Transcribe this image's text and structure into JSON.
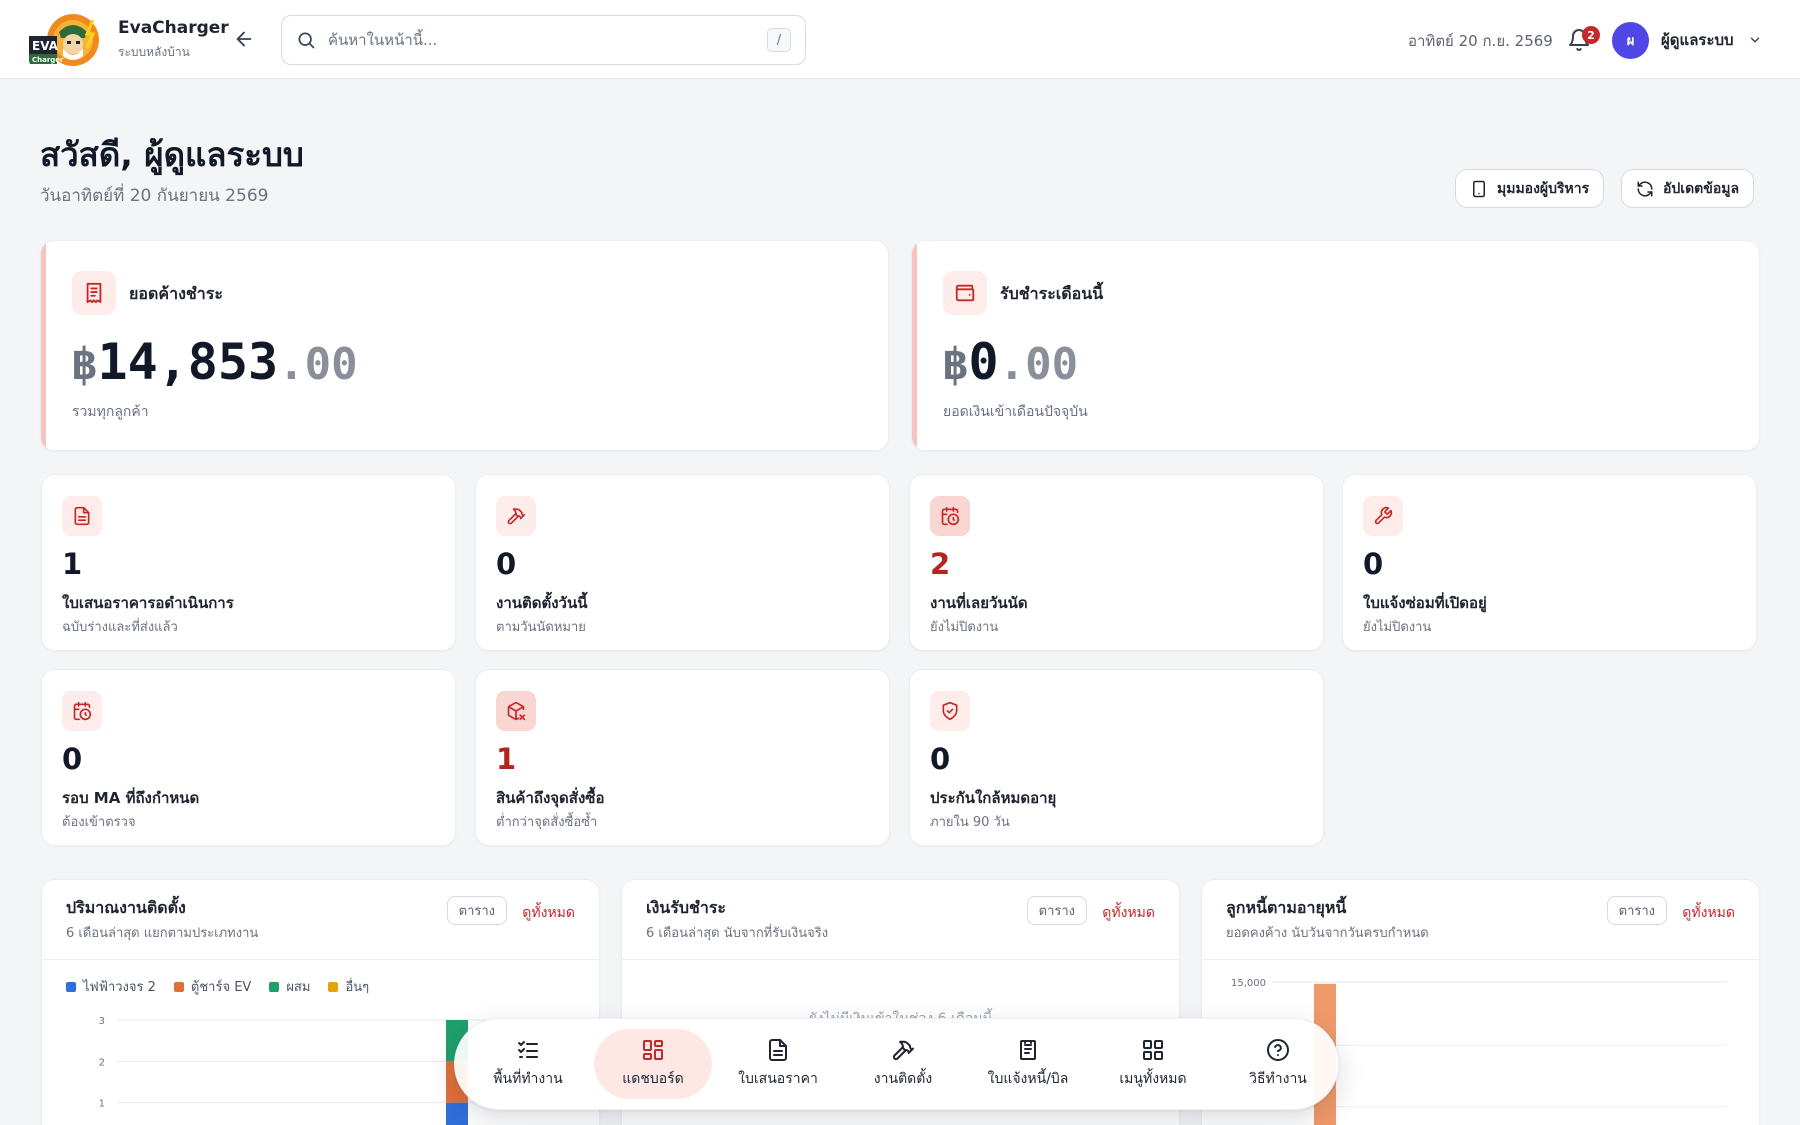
{
  "app": {
    "name": "EvaCharger",
    "subtitle": "ระบบหลังบ้าน",
    "logo_text": "EVA",
    "logo_subtext": "Charger"
  },
  "header": {
    "search_placeholder": "ค้นหาในหน้านี้...",
    "search_shortcut": "/",
    "date": "อาทิตย์ 20 ก.ย. 2569",
    "notification_count": "2",
    "user_initial": "ผ",
    "user_name": "ผู้ดูแลระบบ"
  },
  "greeting": {
    "title": "สวัสดี, ผู้ดูแลระบบ",
    "date": "วันอาทิตย์ที่ 20 กันยายน 2569",
    "executive_view_label": "มุมมองผู้บริหาร",
    "refresh_label": "อัปเดตข้อมูล"
  },
  "money_cards": [
    {
      "label": "ยอดค้างชำระ",
      "currency": "฿",
      "amount": "14,853",
      "decimals": ".00",
      "sub": "รวมทุกลูกค้า",
      "icon": "receipt-icon"
    },
    {
      "label": "รับชำระเดือนนี้",
      "currency": "฿",
      "amount": "0",
      "decimals": ".00",
      "sub": "ยอดเงินเข้าเดือนปัจจุบัน",
      "icon": "wallet-icon"
    }
  ],
  "stats": [
    {
      "value": "1",
      "label": "ใบเสนอราคารอดำเนินการ",
      "sub": "ฉบับร่างและที่ส่งแล้ว",
      "icon": "document-icon",
      "highlight": false
    },
    {
      "value": "0",
      "label": "งานติดตั้งวันนี้",
      "sub": "ตามวันนัดหมาย",
      "icon": "hammer-icon",
      "highlight": false
    },
    {
      "value": "2",
      "label": "งานที่เลยวันนัด",
      "sub": "ยังไม่ปิดงาน",
      "icon": "calendar-clock-icon",
      "highlight": true
    },
    {
      "value": "0",
      "label": "ใบแจ้งซ่อมที่เปิดอยู่",
      "sub": "ยังไม่ปิดงาน",
      "icon": "wrench-icon",
      "highlight": false
    },
    {
      "value": "0",
      "label": "รอบ MA ที่ถึงกำหนด",
      "sub": "ต้องเข้าตรวจ",
      "icon": "calendar-clock-icon",
      "highlight": false
    },
    {
      "value": "1",
      "label": "สินค้าถึงจุดสั่งซื้อ",
      "sub": "ต่ำกว่าจุดสั่งซื้อซ้ำ",
      "icon": "package-x-icon",
      "highlight": true
    },
    {
      "value": "0",
      "label": "ประกันใกล้หมดอายุ",
      "sub": "ภายใน 90 วัน",
      "icon": "shield-check-icon",
      "highlight": false
    }
  ],
  "panels": [
    {
      "title": "ปริมาณงานติดตั้ง",
      "sub": "6 เดือนล่าสุด แยกตามประเภทงาน",
      "table_label": "ตาราง",
      "view_all_label": "ดูทั้งหมด",
      "legend": [
        {
          "name": "ไฟฟ้าวงจร 2",
          "color": "#2f6fdb"
        },
        {
          "name": "ตู้ชาร์จ EV",
          "color": "#e0703a"
        },
        {
          "name": "ผสม",
          "color": "#1fa06b"
        },
        {
          "name": "อื่นๆ",
          "color": "#e5a50a"
        }
      ]
    },
    {
      "title": "เงินรับชำระ",
      "sub": "6 เดือนล่าสุด นับจากที่รับเงินจริง",
      "table_label": "ตาราง",
      "view_all_label": "ดูทั้งหมด",
      "empty_message": "ยังไม่มีเงินเข้าในช่วง 6 เดือนนี้"
    },
    {
      "title": "ลูกหนี้ตามอายุหนี้",
      "sub": "ยอดคงค้าง นับวันจากวันครบกำหนด",
      "table_label": "ตาราง",
      "view_all_label": "ดูทั้งหมด"
    }
  ],
  "chart_data": [
    {
      "type": "bar",
      "stacked": true,
      "y_ticks": [
        "1",
        "2",
        "3"
      ],
      "ylim": [
        0,
        3
      ],
      "series": [
        {
          "name": "ไฟฟ้าวงจร 2",
          "color": "#2f6fdb",
          "values": [
            1
          ]
        },
        {
          "name": "ตู้ชาร์จ EV",
          "color": "#e0703a",
          "values": [
            1
          ]
        },
        {
          "name": "ผสม",
          "color": "#1fa06b",
          "values": [
            1
          ]
        },
        {
          "name": "อื่นๆ",
          "color": "#e5a50a",
          "values": [
            0
          ]
        }
      ]
    },
    {
      "type": "bar",
      "y_ticks": [
        "15,000"
      ],
      "ylim": [
        0,
        15000
      ],
      "series": [
        {
          "color": "#ef9a6a",
          "values": [
            14853
          ]
        }
      ]
    }
  ],
  "dock": [
    {
      "label": "พื้นที่ทำงาน",
      "icon": "list-check-icon",
      "active": false
    },
    {
      "label": "แดชบอร์ด",
      "icon": "grid-icon",
      "active": true
    },
    {
      "label": "ใบเสนอราคา",
      "icon": "document-icon",
      "active": false
    },
    {
      "label": "งานติดตั้ง",
      "icon": "hammer-icon",
      "active": false
    },
    {
      "label": "ใบแจ้งหนี้/บิล",
      "icon": "invoice-icon",
      "active": false
    },
    {
      "label": "เมนูทั้งหมด",
      "icon": "apps-icon",
      "active": false
    },
    {
      "label": "วิธีทำงาน",
      "icon": "help-circle-icon",
      "active": false
    }
  ]
}
